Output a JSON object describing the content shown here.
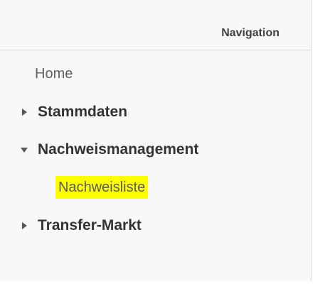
{
  "navigation": {
    "title": "Navigation",
    "items": [
      {
        "label": "Home",
        "icon": "none"
      },
      {
        "label": "Stammdaten",
        "icon": "chevron-right-icon"
      },
      {
        "label": "Nachweismanagement",
        "icon": "chevron-down-icon",
        "children": [
          {
            "label": "Nachweisliste",
            "highlight": "#ffff00"
          }
        ]
      },
      {
        "label": "Transfer-Markt",
        "icon": "chevron-right-icon"
      }
    ]
  }
}
